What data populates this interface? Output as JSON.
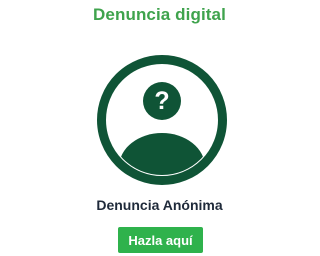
{
  "header": {
    "title": "Denuncia digital"
  },
  "card": {
    "icon": "anonymous-user-icon",
    "badge_icon": "question-mark-icon",
    "badge_glyph": "?",
    "label": "Denuncia Anónima",
    "button_label": "Hazla aquí"
  },
  "colors": {
    "title": "#3fa34d",
    "avatar": "#0f5436",
    "label": "#1f2a3a",
    "button_bg": "#2fb24c",
    "button_text": "#ffffff"
  }
}
